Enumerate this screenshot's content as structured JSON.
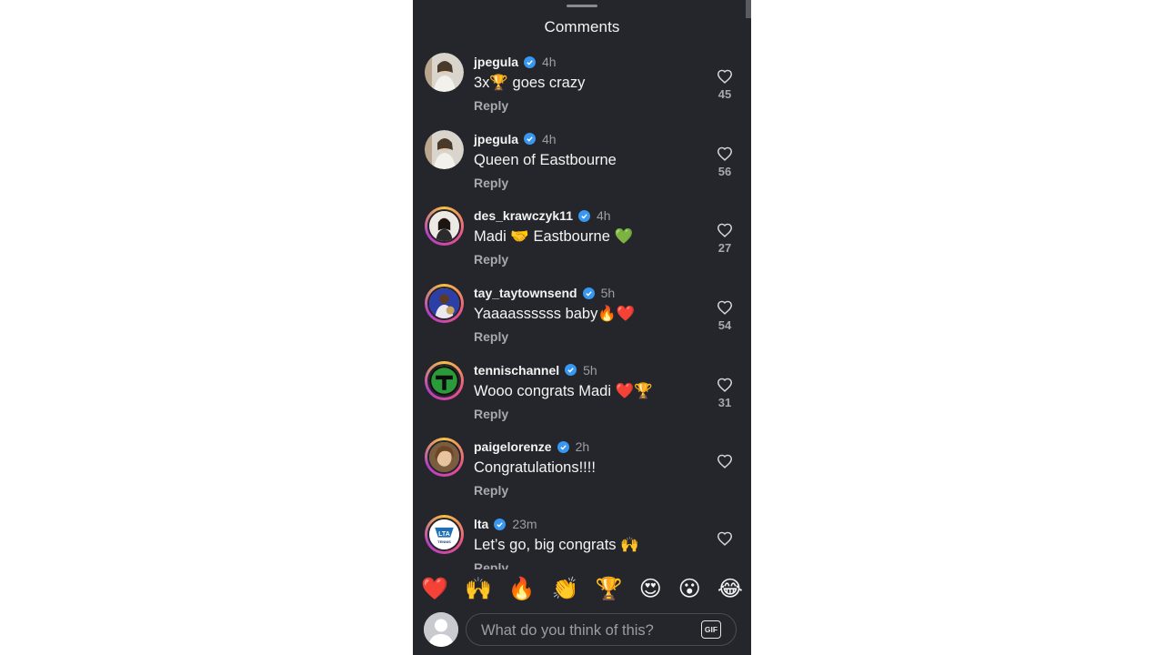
{
  "sheet": {
    "title": "Comments"
  },
  "comments": [
    {
      "username": "jpegula",
      "time": "4h",
      "text": "3x🏆 goes crazy",
      "reply_label": "Reply",
      "likes": "45",
      "avatar_icon": "photo-avatar-icon"
    },
    {
      "username": "jpegula",
      "time": "4h",
      "text": "Queen of Eastbourne",
      "reply_label": "Reply",
      "likes": "56",
      "avatar_icon": "photo-avatar-icon"
    },
    {
      "username": "des_krawczyk11",
      "time": "4h",
      "text": "Madi 🤝 Eastbourne 💚",
      "reply_label": "Reply",
      "likes": "27",
      "avatar_icon": "photo-avatar-icon"
    },
    {
      "username": "tay_taytownsend",
      "time": "5h",
      "text": "Yaaaassssss baby🔥❤️",
      "reply_label": "Reply",
      "likes": "54",
      "avatar_icon": "photo-avatar-icon"
    },
    {
      "username": "tennischannel",
      "time": "5h",
      "text": "Wooo congrats Madi ❤️🏆",
      "reply_label": "Reply",
      "likes": "31",
      "avatar_icon": "tennis-channel-logo-icon"
    },
    {
      "username": "paigelorenze",
      "time": "2h",
      "text": "Congratulations!!!!",
      "reply_label": "Reply",
      "likes": "",
      "avatar_icon": "photo-avatar-icon"
    },
    {
      "username": "lta",
      "time": "23m",
      "text": "Let’s go, big congrats 🙌",
      "reply_label": "Reply",
      "likes": "",
      "avatar_icon": "lta-logo-icon"
    }
  ],
  "lta_logo_text": "LTA",
  "lta_logo_subtext": "TENNIS",
  "reactions": [
    "❤️",
    "🙌",
    "🔥",
    "👏",
    "🏆",
    "😍",
    "😮",
    "😂"
  ],
  "composer": {
    "placeholder": "What do you think of this?",
    "gif_label": "GIF"
  },
  "colors": {
    "background": "#25262b",
    "verified": "#3897f0",
    "tennis_channel": "#2a9a3a"
  }
}
